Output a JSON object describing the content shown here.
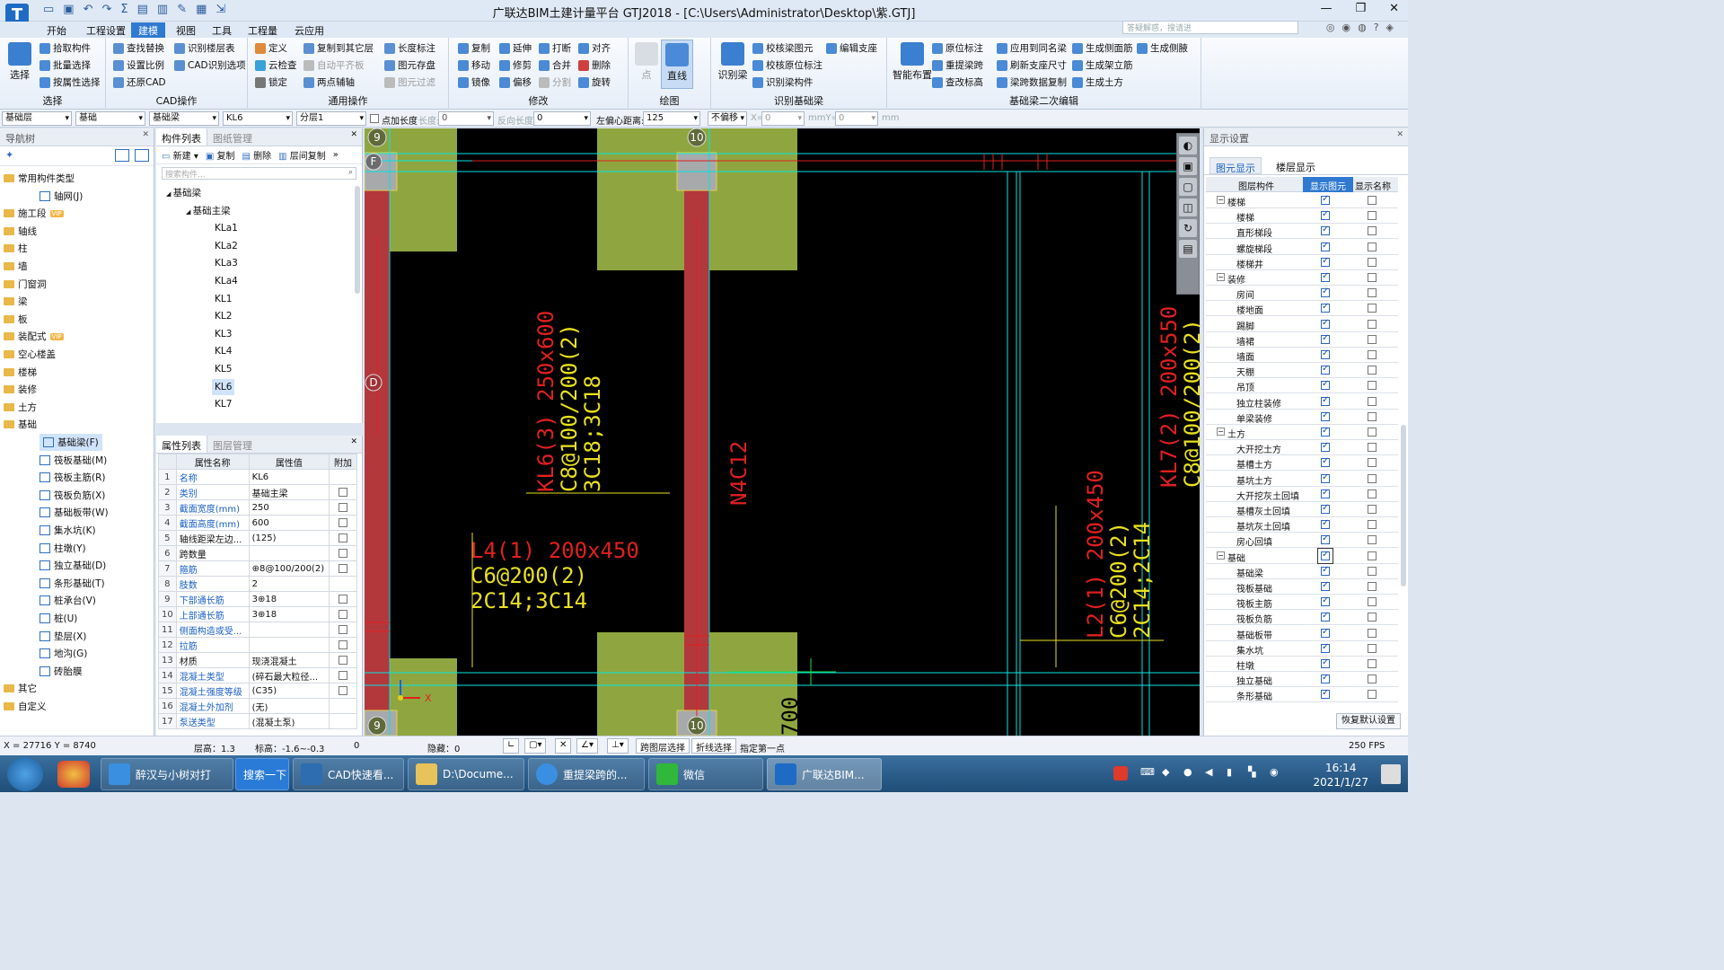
{
  "window": {
    "title": "广联达BIM土建计量平台 GTJ2018 - [C:\\Users\\Administrator\\Desktop\\紫.GTJ]",
    "logo_letter": "T"
  },
  "ribbon_tabs": [
    "开始",
    "工程设置",
    "建模",
    "视图",
    "工具",
    "工程量",
    "云应用"
  ],
  "help_search_placeholder": "答疑解惑，搜请进",
  "ribbon": {
    "select": {
      "big": "选择",
      "items": [
        "拾取构件",
        "批量选择",
        "按属性选择"
      ],
      "label": "选择"
    },
    "cad": {
      "items": [
        "查找替换",
        "设置比例",
        "还原CAD",
        "识别楼层表",
        "CAD识别选项"
      ],
      "label": "CAD操作"
    },
    "general": {
      "items": [
        "定义",
        "云检查",
        "锁定",
        "复制到其它层",
        "自动平齐板",
        "两点辅轴",
        "长度标注",
        "图元存盘",
        "图元过滤"
      ],
      "label": "通用操作"
    },
    "modify": {
      "items": [
        "复制",
        "延伸",
        "打断",
        "对齐",
        "移动",
        "修剪",
        "合并",
        "删除",
        "镜像",
        "偏移",
        "分割",
        "旋转"
      ],
      "label": "修改"
    },
    "draw": {
      "items": [
        "点",
        "直线"
      ],
      "label": "绘图"
    },
    "identify": {
      "big": "识别梁",
      "items": [
        "校核梁图元",
        "校核原位标注",
        "识别梁构件",
        "编辑支座"
      ],
      "label": "识别基础梁"
    },
    "secondary": {
      "big": "智能布置",
      "items": [
        "原位标注",
        "重提梁跨",
        "查改标高",
        "应用到同名梁",
        "刷新支座尺寸",
        "梁跨数据复制",
        "生成侧面筋",
        "生成架立筋",
        "生成土方",
        "生成侧腋"
      ],
      "label": "基础梁二次编辑"
    }
  },
  "propbar": {
    "floor_type": "基础层",
    "category": "基础",
    "subtype": "基础梁",
    "member": "KL6",
    "layer": "分层1",
    "add_length_label": "点加长度",
    "length_label": "长度:",
    "length_value": "0",
    "reverse_label": "反向长度:",
    "reverse_value": "0",
    "offset_label": "左偏心距离:",
    "offset_value": "125",
    "no_offset": "不偏移",
    "x_label": "X=",
    "x_value": "0",
    "mm_y_label": "mmY=",
    "y_value": "0",
    "mm_label": "mm"
  },
  "nav": {
    "title": "导航树",
    "items": [
      {
        "label": "常用构件类型",
        "vip": ""
      },
      {
        "label": "轴网(J)",
        "sub": true
      },
      {
        "label": "施工段",
        "vip": "VIP"
      },
      {
        "label": "轴线"
      },
      {
        "label": "柱"
      },
      {
        "label": "墙"
      },
      {
        "label": "门窗洞"
      },
      {
        "label": "梁"
      },
      {
        "label": "板"
      },
      {
        "label": "装配式",
        "vip": "VIP"
      },
      {
        "label": "空心楼盖"
      },
      {
        "label": "楼梯"
      },
      {
        "label": "装修"
      },
      {
        "label": "土方"
      },
      {
        "label": "基础"
      },
      {
        "label": "基础梁(F)",
        "sub": true,
        "selected": true
      },
      {
        "label": "筏板基础(M)",
        "sub": true
      },
      {
        "label": "筏板主筋(R)",
        "sub": true
      },
      {
        "label": "筏板负筋(X)",
        "sub": true
      },
      {
        "label": "基础板带(W)",
        "sub": true
      },
      {
        "label": "集水坑(K)",
        "sub": true
      },
      {
        "label": "柱墩(Y)",
        "sub": true
      },
      {
        "label": "独立基础(D)",
        "sub": true
      },
      {
        "label": "条形基础(T)",
        "sub": true
      },
      {
        "label": "桩承台(V)",
        "sub": true
      },
      {
        "label": "桩(U)",
        "sub": true
      },
      {
        "label": "垫层(X)",
        "sub": true
      },
      {
        "label": "地沟(G)",
        "sub": true
      },
      {
        "label": "砖胎膜",
        "sub": true
      },
      {
        "label": "其它"
      },
      {
        "label": "自定义"
      }
    ]
  },
  "complist": {
    "tab_active": "构件列表",
    "tab_other": "图纸管理",
    "tools": [
      "新建",
      "复制",
      "删除",
      "层间复制"
    ],
    "search_placeholder": "搜索构件...",
    "tree": [
      {
        "label": "基础梁",
        "level": 0
      },
      {
        "label": "基础主梁",
        "level": 1
      },
      {
        "label": "KLa1",
        "level": 2
      },
      {
        "label": "KLa2",
        "level": 2
      },
      {
        "label": "KLa3",
        "level": 2
      },
      {
        "label": "KLa4",
        "level": 2
      },
      {
        "label": "KL1",
        "level": 2
      },
      {
        "label": "KL2",
        "level": 2
      },
      {
        "label": "KL3",
        "level": 2
      },
      {
        "label": "KL4",
        "level": 2
      },
      {
        "label": "KL5",
        "level": 2
      },
      {
        "label": "KL6",
        "level": 2,
        "selected": true
      },
      {
        "label": "KL7",
        "level": 2
      }
    ]
  },
  "props": {
    "tab_active": "属性列表",
    "tab_other": "图层管理",
    "headers": [
      "属性名称",
      "属性值",
      "附加"
    ],
    "rows": [
      {
        "n": "1",
        "k": "名称",
        "v": "KL6",
        "blue": true,
        "cb": false
      },
      {
        "n": "2",
        "k": "类别",
        "v": "基础主梁",
        "blue": true,
        "cb": true
      },
      {
        "n": "3",
        "k": "截面宽度(mm)",
        "v": "250",
        "blue": true,
        "cb": true
      },
      {
        "n": "4",
        "k": "截面高度(mm)",
        "v": "600",
        "blue": true,
        "cb": true
      },
      {
        "n": "5",
        "k": "轴线距梁左边...",
        "v": "(125)",
        "blue": false,
        "cb": true
      },
      {
        "n": "6",
        "k": "跨数量",
        "v": "",
        "blue": false,
        "cb": true
      },
      {
        "n": "7",
        "k": "箍筋",
        "v": "⊕8@100/200(2)",
        "blue": true,
        "cb": true
      },
      {
        "n": "8",
        "k": "肢数",
        "v": "2",
        "blue": true,
        "cb": false
      },
      {
        "n": "9",
        "k": "下部通长筋",
        "v": "3⊕18",
        "blue": true,
        "cb": true
      },
      {
        "n": "10",
        "k": "上部通长筋",
        "v": "3⊕18",
        "blue": true,
        "cb": true
      },
      {
        "n": "11",
        "k": "侧面构造或受...",
        "v": "",
        "blue": true,
        "cb": true
      },
      {
        "n": "12",
        "k": "拉筋",
        "v": "",
        "blue": true,
        "cb": true
      },
      {
        "n": "13",
        "k": "材质",
        "v": "现浇混凝土",
        "blue": false,
        "cb": true
      },
      {
        "n": "14",
        "k": "混凝土类型",
        "v": "(碎石最大粒径...",
        "blue": true,
        "cb": true
      },
      {
        "n": "15",
        "k": "混凝土强度等级",
        "v": "(C35)",
        "blue": true,
        "cb": true
      },
      {
        "n": "16",
        "k": "混凝土外加剂",
        "v": "(无)",
        "blue": true,
        "cb": false
      },
      {
        "n": "17",
        "k": "泵送类型",
        "v": "(混凝土泵)",
        "blue": true,
        "cb": false
      }
    ]
  },
  "canvas": {
    "axis_labels": [
      "9",
      "10",
      "F",
      "D",
      "9",
      "10"
    ],
    "annotations": [
      {
        "line1": "KL6(3) 250x600",
        "line2": "C8@100/200(2)",
        "line3": "3C18;3C18"
      },
      {
        "line1": "L4(1) 200x450",
        "line2": "C6@200(2)",
        "line3": "2C14;3C14"
      },
      {
        "line1": "L2(1) 200x450",
        "line2": "C6@200(2)",
        "line3": "2C14;2C14"
      },
      {
        "line1": "KL7(2) 200x550",
        "line2": "C8@100/200(2)",
        "line3": ""
      },
      {
        "line1": "N4C12",
        "line2": "",
        "line3": ""
      },
      {
        "line1": "700",
        "line2": "",
        "line3": ""
      }
    ],
    "axis_x": "X"
  },
  "display": {
    "title": "显示设置",
    "tab_active": "图元显示",
    "tab_other": "楼层显示",
    "headers": [
      "图层构件",
      "显示图元",
      "显示名称"
    ],
    "rows": [
      {
        "label": "楼梯",
        "type": "grp"
      },
      {
        "label": "楼梯",
        "type": "it"
      },
      {
        "label": "直形梯段",
        "type": "it"
      },
      {
        "label": "螺旋梯段",
        "type": "it"
      },
      {
        "label": "楼梯井",
        "type": "it"
      },
      {
        "label": "装修",
        "type": "grp"
      },
      {
        "label": "房间",
        "type": "it"
      },
      {
        "label": "楼地面",
        "type": "it"
      },
      {
        "label": "踢脚",
        "type": "it"
      },
      {
        "label": "墙裙",
        "type": "it"
      },
      {
        "label": "墙面",
        "type": "it"
      },
      {
        "label": "天棚",
        "type": "it"
      },
      {
        "label": "吊顶",
        "type": "it"
      },
      {
        "label": "独立柱装修",
        "type": "it"
      },
      {
        "label": "单梁装修",
        "type": "it"
      },
      {
        "label": "土方",
        "type": "grp"
      },
      {
        "label": "大开挖土方",
        "type": "it"
      },
      {
        "label": "基槽土方",
        "type": "it"
      },
      {
        "label": "基坑土方",
        "type": "it"
      },
      {
        "label": "大开挖灰土回填",
        "type": "it"
      },
      {
        "label": "基槽灰土回填",
        "type": "it"
      },
      {
        "label": "基坑灰土回填",
        "type": "it"
      },
      {
        "label": "房心回填",
        "type": "it"
      },
      {
        "label": "基础",
        "type": "grp"
      },
      {
        "label": "基础梁",
        "type": "it"
      },
      {
        "label": "筏板基础",
        "type": "it"
      },
      {
        "label": "筏板主筋",
        "type": "it"
      },
      {
        "label": "筏板负筋",
        "type": "it"
      },
      {
        "label": "基础板带",
        "type": "it"
      },
      {
        "label": "集水坑",
        "type": "it"
      },
      {
        "label": "柱墩",
        "type": "it"
      },
      {
        "label": "独立基础",
        "type": "it"
      },
      {
        "label": "条形基础",
        "type": "it"
      }
    ],
    "reset_label": "恢复默认设置"
  },
  "status": {
    "coords": "X = 27716 Y = 8740",
    "floor_height": "层高：1.3",
    "elevation": "标高：-1.6~-0.3",
    "count": "0",
    "hidden": "隐藏：0",
    "cross_layer": "跨图层选择",
    "polyline": "折线选择",
    "hint": "指定第一点",
    "fps": "250 FPS"
  },
  "taskbar": {
    "items": [
      "醉汉与小树对打",
      "搜索一下",
      "CAD快速看...",
      "D:\\Docume...",
      "重提梁跨的...",
      "微信",
      "广联达BIM..."
    ],
    "time": "16:14",
    "date": "2021/1/27"
  },
  "colors": {
    "accent": "#2f7ad0",
    "beam_red": "#b3383c",
    "olive": "#8fa640",
    "canvas_bg": "#000000",
    "cyan": "#00e5e5",
    "annot_red": "#e02020",
    "annot_yellow": "#e8e020"
  }
}
